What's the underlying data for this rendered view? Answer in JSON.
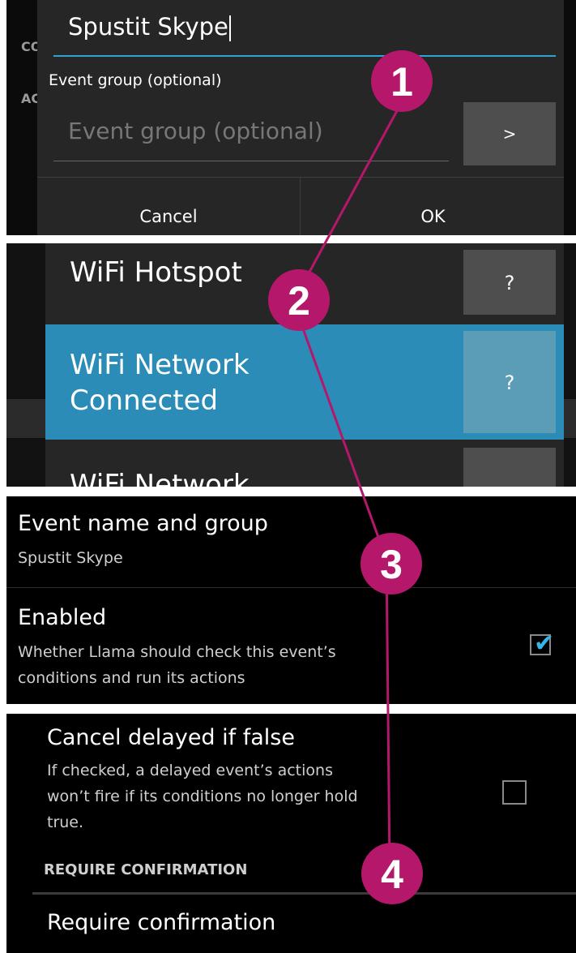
{
  "panel1": {
    "bg_labels": [
      "CO",
      "AC"
    ],
    "dialog": {
      "name_value": "Spustit Skype",
      "group_label": "Event group (optional)",
      "group_placeholder": "Event group (optional)",
      "arrow_label": ">",
      "cancel_label": "Cancel",
      "ok_label": "OK"
    }
  },
  "panel2": {
    "items": [
      {
        "label": "WiFi Hotspot",
        "help": "?"
      },
      {
        "label": "WiFi Network Connected",
        "line1": "WiFi Network",
        "line2": "Connected",
        "help": "?"
      },
      {
        "label": "WiFi Network",
        "help": ""
      }
    ]
  },
  "panel3": {
    "event_name_title": "Event name and group",
    "event_name_summary": "Spustit Skype",
    "enabled_title": "Enabled",
    "enabled_summary_1": "Whether Llama should check this event’s",
    "enabled_summary_2": "conditions and run its actions",
    "enabled_checked": true
  },
  "panel4": {
    "cancel_title": "Cancel delayed if false",
    "cancel_summary_1": "If checked, a delayed event’s actions",
    "cancel_summary_2": "won’t fire if its conditions no longer hold",
    "cancel_summary_3": "true.",
    "cancel_checked": false,
    "section_header": "REQUIRE CONFIRMATION",
    "require_title": "Require confirmation"
  },
  "callouts": [
    "1",
    "2",
    "3",
    "4"
  ],
  "colors": {
    "accent": "#33b5e5",
    "selected": "#2a8cb7",
    "callout": "#b5176b"
  }
}
